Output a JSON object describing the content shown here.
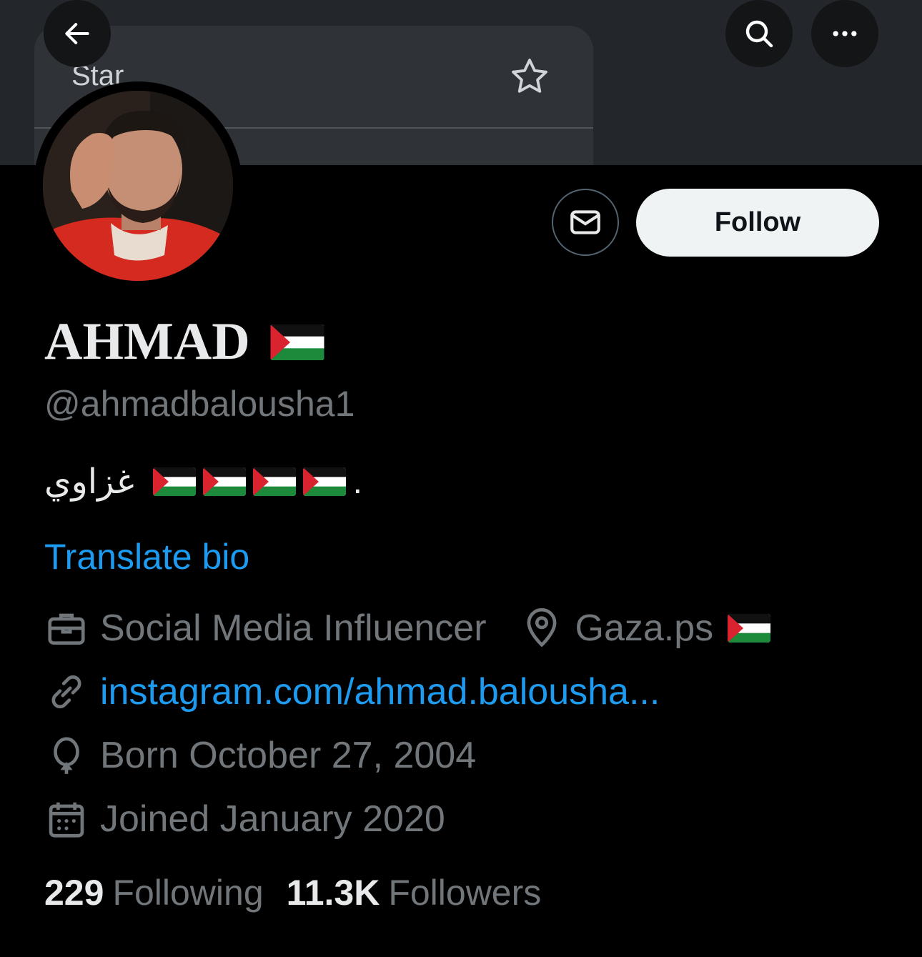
{
  "banner": {
    "card_text": "Star"
  },
  "profile": {
    "name": "AHMAD",
    "handle": "@ahmadbalousha1",
    "bio_text": "غزاوي",
    "bio_suffix": ".",
    "translate_label": "Translate bio",
    "profession": "Social Media Influencer",
    "location": "Gaza.ps",
    "website": "instagram.com/ahmad.balousha...",
    "birthday": "Born October 27, 2004",
    "joined": "Joined January 2020"
  },
  "stats": {
    "following_count": "229",
    "following_label": "Following",
    "followers_count": "11.3K",
    "followers_label": "Followers"
  },
  "actions": {
    "follow_label": "Follow"
  },
  "icons": {
    "back": "back-arrow-icon",
    "search": "search-icon",
    "more": "more-icon",
    "message": "envelope-icon",
    "briefcase": "briefcase-icon",
    "location": "location-pin-icon",
    "link": "link-icon",
    "birthday": "balloon-icon",
    "calendar": "calendar-icon",
    "flag": "palestine-flag-icon",
    "star": "star-icon"
  },
  "colors": {
    "accent": "#1d9bf0",
    "muted": "#71767b",
    "text": "#e7e9ea",
    "background": "#000000"
  }
}
